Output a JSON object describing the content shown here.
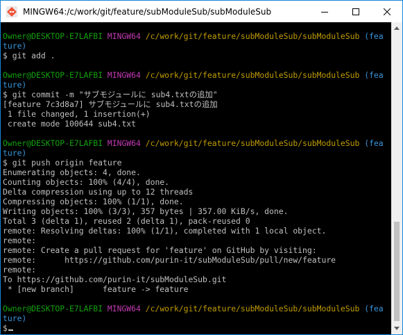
{
  "window": {
    "title": "MINGW64:/c/work/git/feature/subModuleSub/subModuleSub"
  },
  "colors": {
    "user": "#13a10e",
    "msystem": "#c239b3",
    "path": "#c19c00",
    "branch": "#3a96dd",
    "text": "#c0c0c0",
    "background": "#000000"
  },
  "icons": {
    "app": "git-bash-icon",
    "minimize": "minimize-icon",
    "maximize": "maximize-icon",
    "close": "close-icon"
  },
  "terminal": {
    "prompt": {
      "user": "Owner@DESKTOP-E7LAFBI",
      "msystem": "MINGW64",
      "path": "/c/work/git/feature/subModuleSub/subModuleSub",
      "branch_open": "(fea",
      "branch_close": "ture)"
    },
    "cmd1": "$ git add .",
    "cmd2": "$ git commit -m \"サブモジュールに sub4.txtの追加\"",
    "commit": [
      "[feature 7c3d8a7] サブモジュールに sub4.txtの追加",
      " 1 file changed, 1 insertion(+)",
      " create mode 100644 sub4.txt"
    ],
    "cmd3": "$ git push origin feature",
    "push": [
      "Enumerating objects: 4, done.",
      "Counting objects: 100% (4/4), done.",
      "Delta compression using up to 12 threads",
      "Compressing objects: 100% (1/1), done.",
      "Writing objects: 100% (3/3), 357 bytes | 357.00 KiB/s, done.",
      "Total 3 (delta 1), reused 2 (delta 1), pack-reused 0",
      "remote: Resolving deltas: 100% (1/1), completed with 1 local object.",
      "remote:",
      "remote: Create a pull request for 'feature' on GitHub by visiting:",
      "remote:      https://github.com/purin-it/subModuleSub/pull/new/feature",
      "remote:",
      "To https://github.com/purin-it/subModuleSub.git",
      " * [new branch]      feature -> feature"
    ],
    "final_prompt": "$"
  }
}
